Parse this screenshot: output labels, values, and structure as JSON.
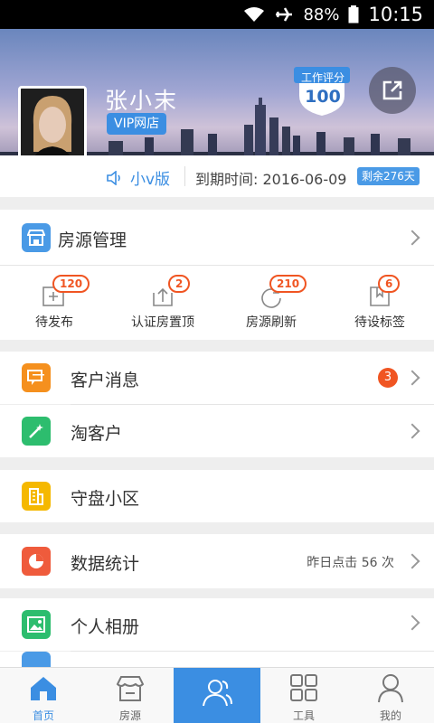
{
  "status_bar": {
    "battery": "88%",
    "time": "10:15"
  },
  "profile": {
    "name": "张小末",
    "vip_label": "VIP网店",
    "score_label": "工作评分",
    "score_value": "100",
    "version": "小v版",
    "expire_label": "到期时间:",
    "expire_date": "2016-06-09",
    "remaining": "剩余276天"
  },
  "house_mgmt": {
    "label": "房源管理"
  },
  "quick_actions": [
    {
      "label": "待发布",
      "badge": "120",
      "icon": "add-image-icon"
    },
    {
      "label": "认证房置顶",
      "badge": "2",
      "icon": "upload-icon"
    },
    {
      "label": "房源刷新",
      "badge": "210",
      "icon": "refresh-icon"
    },
    {
      "label": "待设标签",
      "badge": "6",
      "icon": "tag-icon"
    }
  ],
  "menu": {
    "messages": {
      "label": "客户消息",
      "badge": "3"
    },
    "find_customers": {
      "label": "淘客户"
    },
    "community": {
      "label": "守盘小区"
    },
    "stats": {
      "label": "数据统计",
      "extra": "昨日点击 56 次"
    },
    "album": {
      "label": "个人相册"
    }
  },
  "tabs": [
    {
      "label": "首页",
      "icon": "home-icon"
    },
    {
      "label": "房源",
      "icon": "shop-icon"
    },
    {
      "label": "",
      "icon": "people-icon"
    },
    {
      "label": "工具",
      "icon": "grid-icon"
    },
    {
      "label": "我的",
      "icon": "person-icon"
    }
  ],
  "colors": {
    "accent": "#3b8ee2",
    "badge_orange": "#f05522",
    "icon_blue": "#4a9ae6",
    "icon_orange": "#f5901e",
    "icon_green": "#2dbd6e",
    "icon_yellow": "#f5b800",
    "icon_red": "#ef5b3c"
  }
}
